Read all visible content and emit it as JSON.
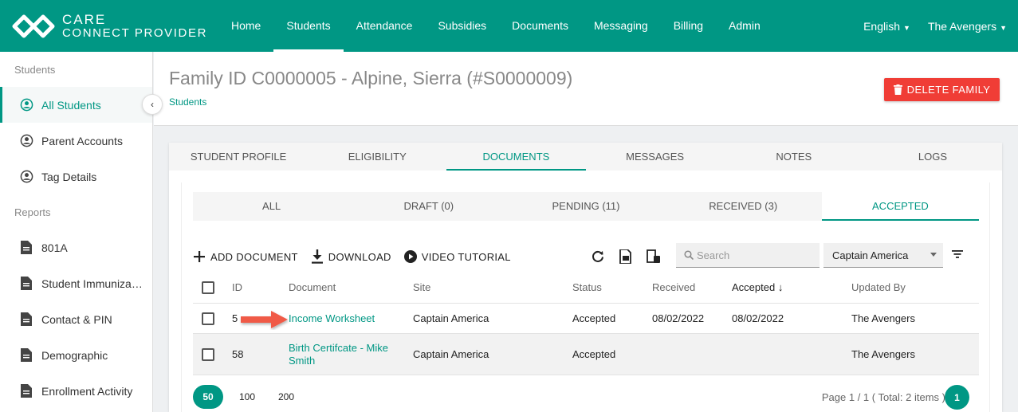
{
  "brand": {
    "line1": "CARE",
    "line2": "CONNECT PROVIDER"
  },
  "nav": [
    {
      "label": "Home"
    },
    {
      "label": "Students",
      "active": true
    },
    {
      "label": "Attendance"
    },
    {
      "label": "Subsidies"
    },
    {
      "label": "Documents"
    },
    {
      "label": "Messaging"
    },
    {
      "label": "Billing"
    },
    {
      "label": "Admin"
    }
  ],
  "language": "English",
  "account": "The Avengers",
  "sidebar": {
    "students_heading": "Students",
    "students_items": [
      "All Students",
      "Parent Accounts",
      "Tag Details"
    ],
    "reports_heading": "Reports",
    "reports_items": [
      "801A",
      "Student Immuniza…",
      "Contact & PIN",
      "Demographic",
      "Enrollment Activity"
    ]
  },
  "header": {
    "title": "Family ID C0000005 - Alpine, Sierra (#S0000009)",
    "breadcrumb": "Students",
    "delete_label": "DELETE FAMILY"
  },
  "tabs": [
    "STUDENT PROFILE",
    "ELIGIBILITY",
    "DOCUMENTS",
    "MESSAGES",
    "NOTES",
    "LOGS"
  ],
  "subtabs": [
    "ALL",
    "DRAFT (0)",
    "PENDING (11)",
    "RECEIVED (3)",
    "ACCEPTED"
  ],
  "toolbar": {
    "add_label": "ADD DOCUMENT",
    "download_label": "DOWNLOAD",
    "video_label": "VIDEO TUTORIAL",
    "search_placeholder": "Search",
    "site_select": "Captain America"
  },
  "table": {
    "headers": {
      "id": "ID",
      "document": "Document",
      "site": "Site",
      "status": "Status",
      "received": "Received",
      "accepted": "Accepted ↓",
      "updated_by": "Updated By"
    },
    "rows": [
      {
        "id": "5",
        "document": "Income Worksheet",
        "site": "Captain America",
        "status": "Accepted",
        "received": "08/02/2022",
        "accepted": "08/02/2022",
        "updated_by": "The Avengers"
      },
      {
        "id": "58",
        "document": "Birth Certifcate - Mike Smith",
        "site": "Captain America",
        "status": "Accepted",
        "received": "",
        "accepted": "",
        "updated_by": "The Avengers"
      }
    ]
  },
  "pagination": {
    "page_sizes": [
      "50",
      "100",
      "200"
    ],
    "info": "Page 1 / 1 ( Total: 2 items )",
    "current": "1"
  },
  "colors": {
    "brand": "#009784",
    "danger": "#f03d36",
    "annotation_arrow": "#f05a47"
  }
}
